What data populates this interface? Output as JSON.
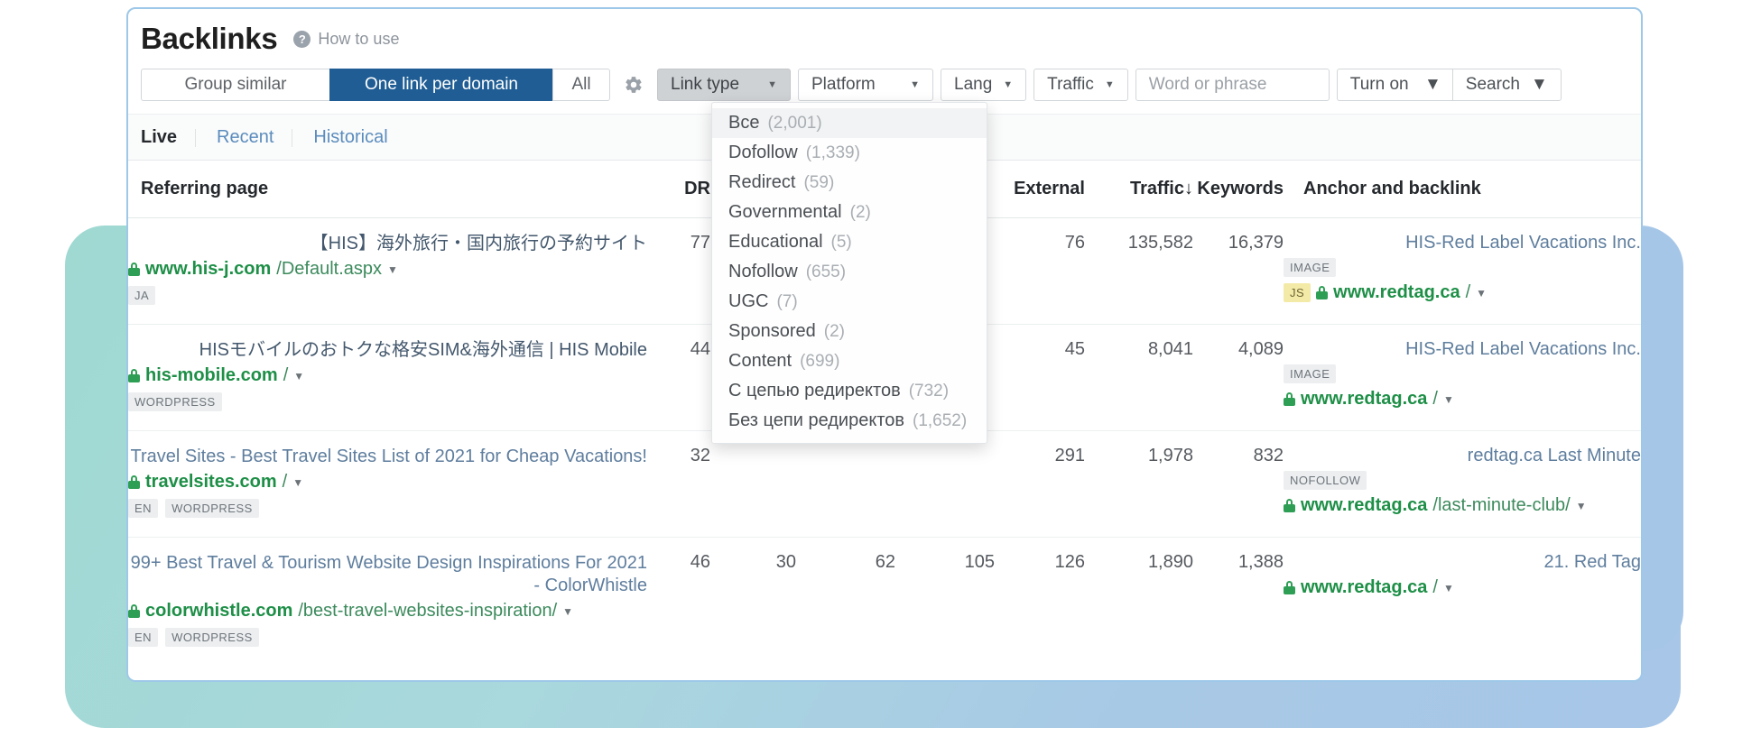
{
  "header": {
    "title": "Backlinks",
    "help_icon": "question-mark-icon",
    "help_label": "How to use"
  },
  "toolbar": {
    "segments": [
      {
        "label": "Group similar",
        "active": false
      },
      {
        "label": "One link per domain",
        "active": true
      },
      {
        "label": "All",
        "active": false
      }
    ],
    "gear_icon": "gear-icon",
    "filters": [
      {
        "name": "link-type",
        "label": "Link type",
        "pressed": true
      },
      {
        "name": "platform",
        "label": "Platform",
        "pressed": false
      },
      {
        "name": "lang",
        "label": "Lang",
        "pressed": false
      },
      {
        "name": "traffic",
        "label": "Traffic",
        "pressed": false
      }
    ],
    "word_input_placeholder": "Word or phrase",
    "word_input_value": "",
    "turn_on_label": "Turn on",
    "search_label": "Search",
    "active_segment_color": "#1f5d94"
  },
  "tabs": [
    {
      "label": "Live",
      "active": true
    },
    {
      "label": "Recent",
      "active": false
    },
    {
      "label": "Historical",
      "active": false
    }
  ],
  "dropdown": {
    "open_for": "Link type",
    "items": [
      {
        "label": "Все",
        "count": "(2,001)",
        "highlighted": true
      },
      {
        "label": "Dofollow",
        "count": "(1,339)",
        "highlighted": false
      },
      {
        "label": "Redirect",
        "count": "(59)",
        "highlighted": false
      },
      {
        "label": "Governmental",
        "count": "(2)",
        "highlighted": false
      },
      {
        "label": "Educational",
        "count": "(5)",
        "highlighted": false
      },
      {
        "label": "Nofollow",
        "count": "(655)",
        "highlighted": false
      },
      {
        "label": "UGC",
        "count": "(7)",
        "highlighted": false
      },
      {
        "label": "Sponsored",
        "count": "(2)",
        "highlighted": false
      },
      {
        "label": "Content",
        "count": "(699)",
        "highlighted": false
      },
      {
        "label": "С цепью редиректов",
        "count": "(732)",
        "highlighted": false
      },
      {
        "label": "Без цепи редиректов",
        "count": "(1,652)",
        "highlighted": false
      }
    ]
  },
  "table": {
    "columns": [
      {
        "key": "referring_page",
        "label": "Referring page",
        "align": "left"
      },
      {
        "key": "dr",
        "label": "DR",
        "align": "right"
      },
      {
        "key": "c2",
        "label": "",
        "align": "right"
      },
      {
        "key": "c3",
        "label": "",
        "align": "right"
      },
      {
        "key": "c4",
        "label": "",
        "align": "right"
      },
      {
        "key": "external",
        "label": "External",
        "align": "right"
      },
      {
        "key": "traffic",
        "label": "Traffic",
        "align": "right",
        "sort": "desc"
      },
      {
        "key": "keywords",
        "label": "Keywords",
        "align": "right"
      },
      {
        "key": "anchor",
        "label": "Anchor and backlink",
        "align": "left"
      }
    ],
    "rows": [
      {
        "title": "【HIS】海外旅行・国内旅行の予約サイト",
        "title_lang": "jp",
        "domain": "www.his-j.com",
        "path": "/Default.aspx",
        "badges": [
          "JA"
        ],
        "dr": "77",
        "c2": "",
        "c3": "",
        "c4": "",
        "external": "76",
        "traffic": "135,582",
        "keywords": "16,379",
        "anchor_title": "HIS-Red Label Vacations Inc.",
        "anchor_badge": "IMAGE",
        "anchor_js_badge": "JS",
        "anchor_domain": "www.redtag.ca",
        "anchor_path": "/"
      },
      {
        "title": "HISモバイルのおトクな格安SIM&海外通信 | HIS Mobile",
        "title_lang": "jp",
        "domain": "his-mobile.com",
        "path": "/",
        "badges": [
          "WORDPRESS"
        ],
        "dr": "44",
        "c2": "",
        "c3": "",
        "c4": "",
        "external": "45",
        "traffic": "8,041",
        "keywords": "4,089",
        "anchor_title": "HIS-Red Label Vacations Inc.",
        "anchor_badge": "IMAGE",
        "anchor_js_badge": "",
        "anchor_domain": "www.redtag.ca",
        "anchor_path": "/"
      },
      {
        "title": "Travel Sites - Best Travel Sites List of 2021 for Cheap Vacations!",
        "title_lang": "en",
        "domain": "travelsites.com",
        "path": "/",
        "badges": [
          "EN",
          "WORDPRESS"
        ],
        "dr": "32",
        "c2": "",
        "c3": "",
        "c4": "",
        "external": "291",
        "traffic": "1,978",
        "keywords": "832",
        "anchor_title": "redtag.ca Last Minute",
        "anchor_badge": "NOFOLLOW",
        "anchor_js_badge": "",
        "anchor_domain": "www.redtag.ca",
        "anchor_path": "/last-minute-club/"
      },
      {
        "title": "99+ Best Travel & Tourism Website Design Inspirations For 2021 - ColorWhistle",
        "title_lang": "en",
        "domain": "colorwhistle.com",
        "path": "/best-travel-websites-inspiration/",
        "badges": [
          "EN",
          "WORDPRESS"
        ],
        "dr": "46",
        "c2": "30",
        "c3": "62",
        "c4": "105",
        "external": "126",
        "traffic": "1,890",
        "keywords": "1,388",
        "anchor_title": "21. Red Tag",
        "anchor_badge": "",
        "anchor_js_badge": "",
        "anchor_domain": "www.redtag.ca",
        "anchor_path": "/"
      }
    ]
  },
  "colors": {
    "accent_blue": "#1f5d94",
    "link_blue": "#4a7fb5",
    "green": "#1e8f47",
    "panel_border": "#9ec8e8",
    "js_badge": "#f4eaa8"
  }
}
